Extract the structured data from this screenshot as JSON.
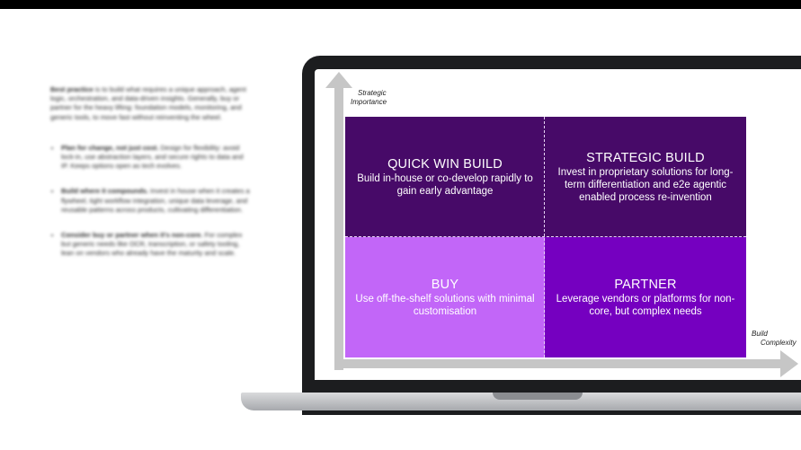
{
  "left_text": {
    "intro_bold": "Best practice",
    "intro_rest": " is to build what requires a unique approach, agent logic, orchestration, and data-driven insights. Generally, buy or partner for the heavy lifting: foundation models, monitoring, and generic tools, to move fast without reinventing the wheel.",
    "bullets": [
      {
        "bold": "Plan for change, not just cost.",
        "rest": " Design for flexibility: avoid lock-in, use abstraction layers, and secure rights to data and IP. Keeps options open as tech evolves."
      },
      {
        "bold": "Build where it compounds.",
        "rest": " Invest in house when it creates a flywheel, tight workflow integration, unique data leverage, and reusable patterns across products, cultivating differentiation."
      },
      {
        "bold": "Consider buy or partner when it's non-core.",
        "rest": " For complex but generic needs like OCR, transcription, or safety tooling, lean on vendors who already have the maturity and scale."
      }
    ]
  },
  "axes": {
    "y_label_line1": "Strategic",
    "y_label_line2": "Importance",
    "x_label_line1": "Build",
    "x_label_line2": "Complexity"
  },
  "quadrants": {
    "quick_win": {
      "title": "QUICK WIN BUILD",
      "desc": "Build in-house or co-develop rapidly to gain early advantage",
      "color": "#470a68"
    },
    "strategic": {
      "title": "STRATEGIC BUILD",
      "desc": "Invest in proprietary solutions for long-term differentiation and e2e agentic enabled process re-invention",
      "color": "#470a68"
    },
    "buy": {
      "title": "BUY",
      "desc": "Use off-the-shelf solutions with minimal customisation",
      "color": "#c266f8"
    },
    "partner": {
      "title": "PARTNER",
      "desc": "Leverage vendors or platforms for non-core, but complex needs",
      "color": "#7500c0"
    }
  }
}
